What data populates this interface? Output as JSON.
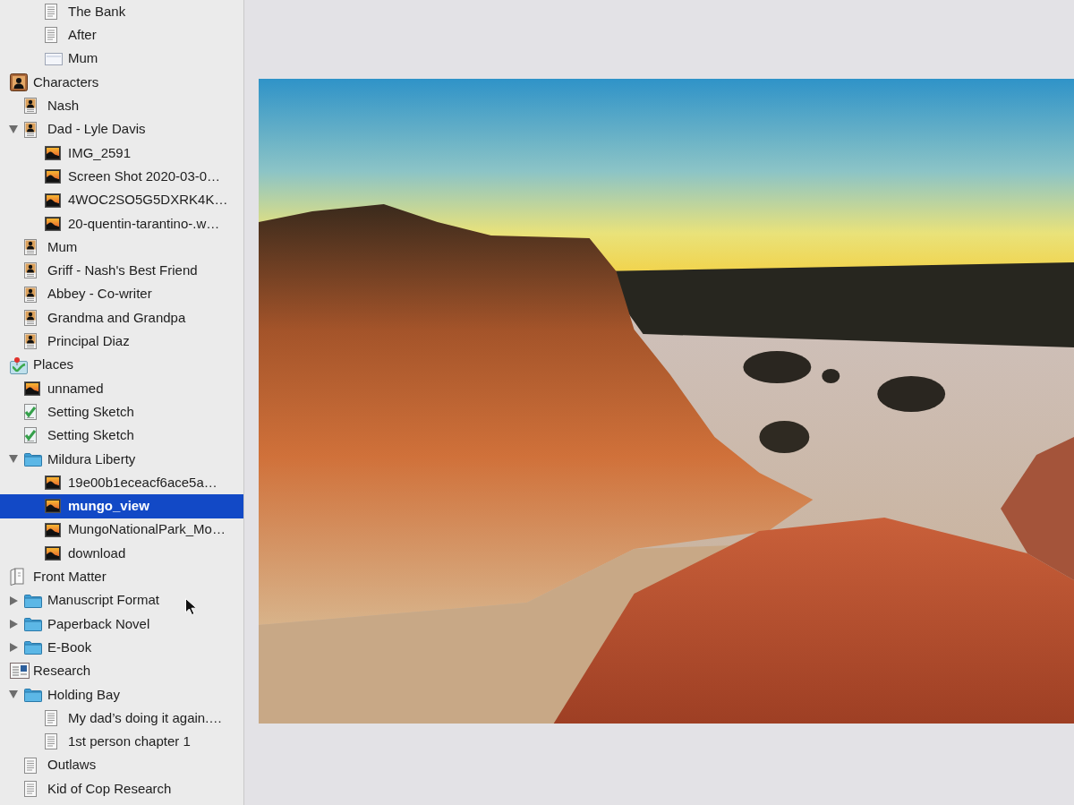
{
  "binder": {
    "continued_items": [
      {
        "title": "The Bank",
        "kind": "text",
        "selected": false
      },
      {
        "title": "After",
        "kind": "text",
        "selected": false
      },
      {
        "title": "Mum",
        "kind": "index-card",
        "selected": false
      }
    ],
    "items": [
      {
        "title": "Characters",
        "kind": "characters-folder",
        "selected": false,
        "children": [
          {
            "title": "Nash",
            "kind": "character",
            "selected": false
          },
          {
            "title": "Dad - Lyle Davis",
            "kind": "character",
            "selected": false,
            "expanded": true,
            "children": [
              {
                "title": "IMG_2591",
                "kind": "image",
                "selected": false
              },
              {
                "title": "Screen Shot 2020-03-0…",
                "kind": "image",
                "selected": false
              },
              {
                "title": "4WOC2SO5G5DXRK4K…",
                "kind": "image",
                "selected": false
              },
              {
                "title": "20-quentin-tarantino-.w…",
                "kind": "image",
                "selected": false
              }
            ]
          },
          {
            "title": "Mum",
            "kind": "character",
            "selected": false
          },
          {
            "title": "Griff - Nash's Best Friend",
            "kind": "character",
            "selected": false
          },
          {
            "title": "Abbey - Co-writer",
            "kind": "character",
            "selected": false
          },
          {
            "title": "Grandma and Grandpa",
            "kind": "character",
            "selected": false
          },
          {
            "title": "Principal Diaz",
            "kind": "character",
            "selected": false
          }
        ]
      },
      {
        "title": "Places",
        "kind": "places-folder",
        "selected": false,
        "children": [
          {
            "title": "unnamed",
            "kind": "image",
            "selected": false
          },
          {
            "title": "Setting Sketch",
            "kind": "sketch",
            "selected": false
          },
          {
            "title": "Setting Sketch",
            "kind": "sketch",
            "selected": false
          },
          {
            "title": "Mildura Liberty",
            "kind": "folder",
            "selected": false,
            "expanded": true,
            "children": [
              {
                "title": "19e00b1eceacf6ace5a…",
                "kind": "image",
                "selected": false
              },
              {
                "title": "mungo_view",
                "kind": "image",
                "selected": true
              },
              {
                "title": "MungoNationalPark_Mo…",
                "kind": "image",
                "selected": false
              },
              {
                "title": "download",
                "kind": "image",
                "selected": false
              }
            ]
          }
        ]
      },
      {
        "title": "Front Matter",
        "kind": "front-matter",
        "selected": false,
        "children": [
          {
            "title": "Manuscript Format",
            "kind": "folder",
            "selected": false,
            "expanded": false
          },
          {
            "title": "Paperback Novel",
            "kind": "folder",
            "selected": false,
            "expanded": false
          },
          {
            "title": "E-Book",
            "kind": "folder",
            "selected": false,
            "expanded": false
          }
        ]
      },
      {
        "title": "Research",
        "kind": "research",
        "selected": false,
        "children": [
          {
            "title": "Holding Bay",
            "kind": "folder",
            "selected": false,
            "expanded": true,
            "children": [
              {
                "title": "My dad’s doing it again.…",
                "kind": "text",
                "selected": false
              },
              {
                "title": "1st person chapter 1",
                "kind": "text",
                "selected": false
              }
            ]
          },
          {
            "title": "Outlaws",
            "kind": "text",
            "selected": false
          },
          {
            "title": "Kid of Cop Research",
            "kind": "text",
            "selected": false
          }
        ]
      }
    ]
  },
  "editor": {
    "kind": "image"
  }
}
